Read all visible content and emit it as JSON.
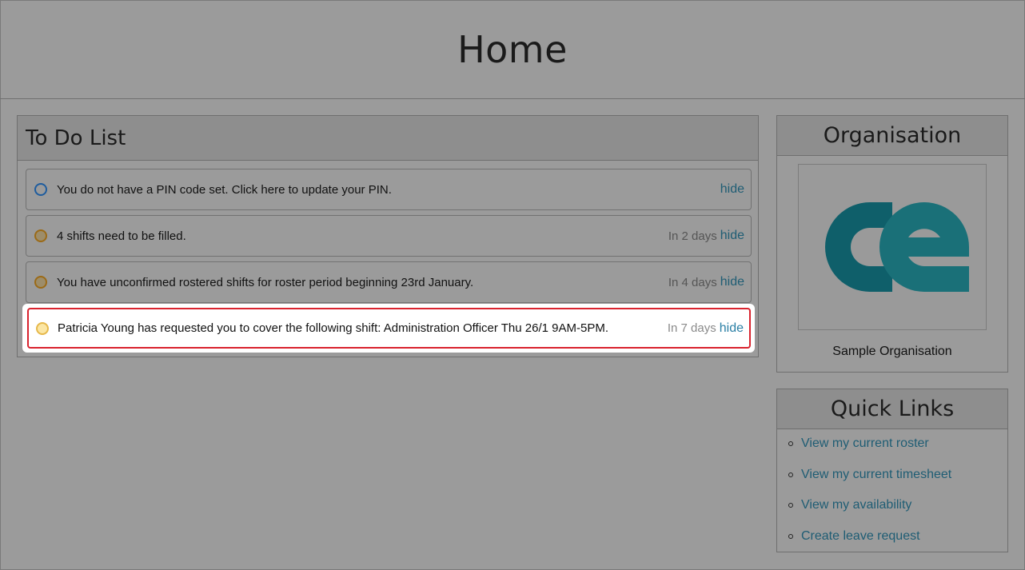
{
  "page": {
    "title": "Home"
  },
  "todo": {
    "title": "To Do List",
    "items": [
      {
        "text": "You do not have a PIN code set. Click here to update your PIN.",
        "due": "",
        "hide": "hide",
        "status": "blue"
      },
      {
        "text": "4 shifts need to be filled.",
        "due": "In 2 days",
        "hide": "hide",
        "status": "orange"
      },
      {
        "text": "You have unconfirmed rostered shifts for roster period beginning 23rd January.",
        "due": "In 4 days",
        "hide": "hide",
        "status": "orange"
      },
      {
        "text": "Patricia Young has requested you to cover the following shift: Administration Officer Thu 26/1 9AM-5PM.",
        "due": "In 7 days",
        "hide": "hide",
        "status": "yellow"
      }
    ]
  },
  "organisation": {
    "title": "Organisation",
    "logo_icon": "ce-logo",
    "logo_colors": [
      "#0f5f6a",
      "#1a7078"
    ],
    "name": "Sample Organisation"
  },
  "quick_links": {
    "title": "Quick Links",
    "items": [
      {
        "label": "View my current roster"
      },
      {
        "label": "View my current timesheet"
      },
      {
        "label": "View my availability"
      },
      {
        "label": "Create leave request"
      }
    ]
  }
}
